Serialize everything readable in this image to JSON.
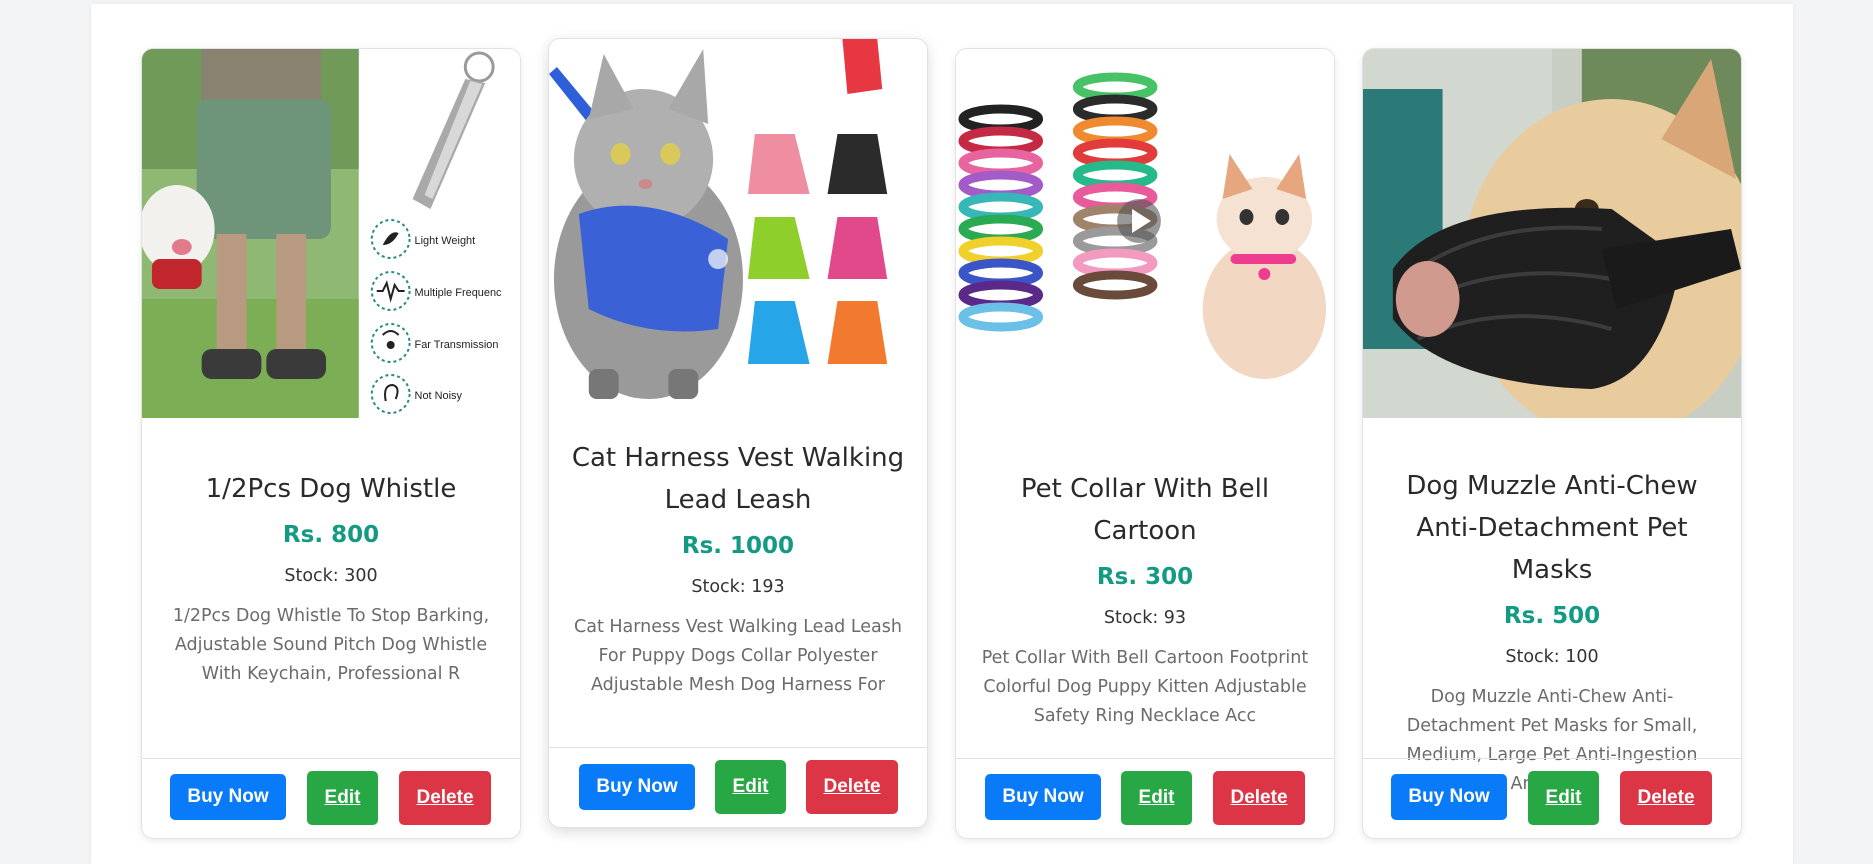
{
  "products": [
    {
      "name": "1/2Pcs Dog Whistle",
      "price": "Rs. 800",
      "stock": "Stock: 300",
      "description": "1/2Pcs Dog Whistle To Stop Barking, Adjustable Sound Pitch Dog Whistle With Keychain, Professional R",
      "image_features": [
        "Light Weight",
        "Multiple Frequenc",
        "Far Transmission",
        "Not Noisy"
      ]
    },
    {
      "name": "Cat Harness Vest Walking Lead Leash",
      "price": "Rs. 1000",
      "stock": "Stock: 193",
      "description": "Cat Harness Vest Walking Lead Leash For Puppy Dogs Collar Polyester Adjustable Mesh Dog Harness For"
    },
    {
      "name": "Pet Collar With Bell Cartoon",
      "price": "Rs. 300",
      "stock": "Stock: 93",
      "description": "Pet Collar With Bell Cartoon Footprint Colorful Dog Puppy Kitten Adjustable Safety Ring Necklace Acc"
    },
    {
      "name": "Dog Muzzle Anti-Chew Anti-Detachment Pet Masks",
      "price": "Rs. 500",
      "stock": "Stock: 100",
      "description": "Dog Muzzle Anti-Chew Anti-Detachment Pet Masks for Small, Medium, Large Pet Anti-Ingestion Anti-Deta"
    }
  ],
  "buttons": {
    "buy": "Buy Now",
    "edit": "Edit",
    "delete": "Delete"
  },
  "colors": {
    "buy": "#0a7bf8",
    "edit": "#28a745",
    "delete": "#dc3545",
    "price": "#139a82"
  }
}
